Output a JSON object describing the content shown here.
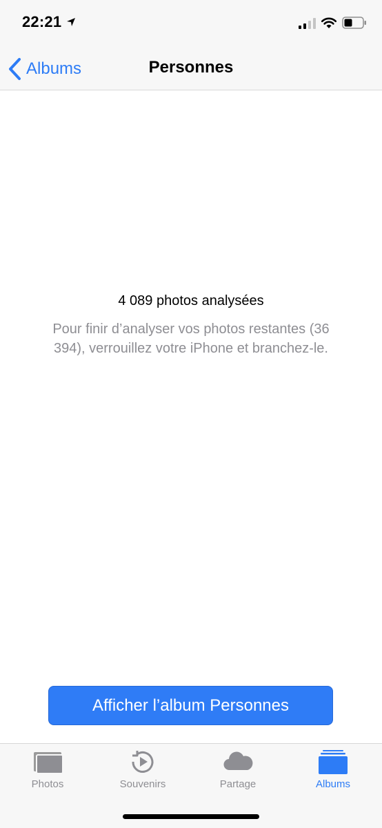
{
  "status_bar": {
    "time": "22:21"
  },
  "nav": {
    "back_label": "Albums",
    "title": "Personnes"
  },
  "main": {
    "analysis_title": "4 089 photos analysées",
    "analysis_detail": "Pour finir d’analyser vos photos restantes (36 394), verrouillez votre iPhone et branchez-le.",
    "button_label": "Afficher l’album Personnes"
  },
  "tabs": [
    {
      "label": "Photos",
      "icon": "photos-icon",
      "active": false
    },
    {
      "label": "Souvenirs",
      "icon": "memories-icon",
      "active": false
    },
    {
      "label": "Partage",
      "icon": "cloud-icon",
      "active": false
    },
    {
      "label": "Albums",
      "icon": "albums-icon",
      "active": true
    }
  ],
  "colors": {
    "accent": "#2D7CF6",
    "secondary_text": "#8E8E93",
    "bar_background": "#F7F7F7"
  }
}
